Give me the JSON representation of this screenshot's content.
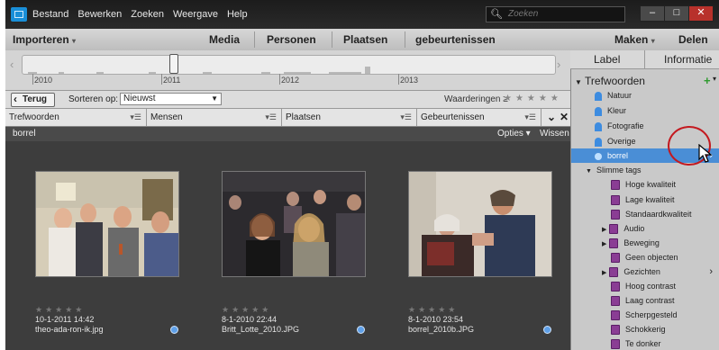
{
  "titlebar": {
    "menu": [
      "Bestand",
      "Bewerken",
      "Zoeken",
      "Weergave",
      "Help"
    ],
    "search_placeholder": "Zoeken",
    "window_buttons": [
      "–",
      "□",
      "✕"
    ]
  },
  "nav": {
    "import_label": "Importeren",
    "views": [
      "Media",
      "Personen",
      "Plaatsen",
      "gebeurtenissen"
    ],
    "create_label": "Maken",
    "share_label": "Delen"
  },
  "timeline": {
    "years": [
      "2010",
      "2011",
      "2012",
      "2013"
    ]
  },
  "panel_tabs": {
    "label": "Label",
    "info": "Informatie"
  },
  "sortbar": {
    "back_label": "Terug",
    "sort_label": "Sorteren op:",
    "sort_value": "Nieuwst",
    "ratings_label": "Waarderingen",
    "ratings_op": "≥",
    "stars": "★★★★★"
  },
  "filters": {
    "keywords": "Trefwoorden",
    "people": "Mensen",
    "places": "Plaatsen",
    "events": "Gebeurtenissen"
  },
  "grid": {
    "query": "borrel",
    "options_label": "Opties",
    "clear_label": "Wissen",
    "items": [
      {
        "stars": "★★★★★",
        "date": "10-1-2011 14:42",
        "filename": "theo-ada-ron-ik.jpg"
      },
      {
        "stars": "★★★★★",
        "date": "8-1-2010 22:44",
        "filename": "Britt_Lotte_2010.JPG"
      },
      {
        "stars": "★★★★★",
        "date": "8-1-2010 23:54",
        "filename": "borrel_2010b.JPG"
      }
    ]
  },
  "sidebar": {
    "root": "Trefwoorden",
    "tags": [
      "Natuur",
      "Kleur",
      "Fotografie",
      "Overige",
      "borrel"
    ],
    "smart_root": "Slimme tags",
    "smart": [
      "Hoge kwaliteit",
      "Lage kwaliteit",
      "Standaardkwaliteit",
      "Audio",
      "Beweging",
      "Geen objecten",
      "Gezichten",
      "Hoog contrast",
      "Laag contrast",
      "Scherpgesteld",
      "Schokkerig",
      "Te donker"
    ]
  }
}
